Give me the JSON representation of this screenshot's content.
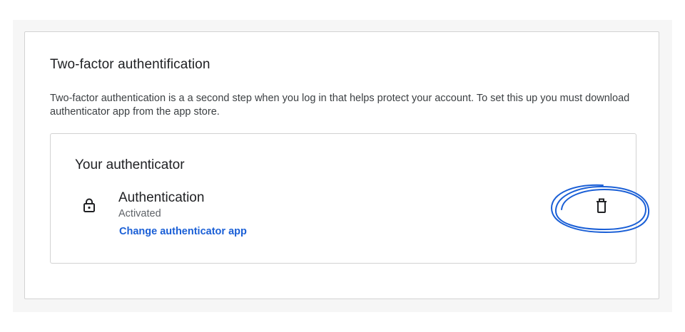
{
  "section": {
    "title": "Two-factor authentification",
    "description": "Two-factor authentication is a a second step when you log in that helps protect your account. To set this up you must download authenticator app from the app store."
  },
  "authenticator": {
    "heading": "Your authenticator",
    "name": "Authentication",
    "status": "Activated",
    "change_link": "Change authenticator app",
    "lock_icon": "lock-icon",
    "delete_icon": "trash-icon"
  },
  "colors": {
    "link": "#1a5fd6",
    "annotation": "#1a5fd6",
    "border": "#d2d2d2"
  }
}
